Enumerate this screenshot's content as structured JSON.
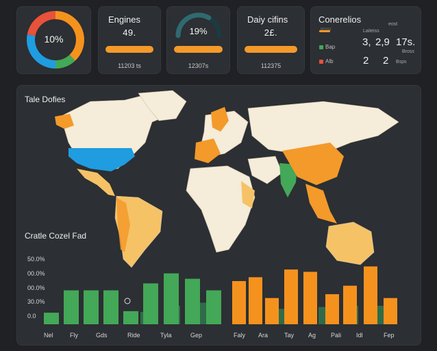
{
  "donut": {
    "label": "10%",
    "segments": [
      {
        "value": 0.38,
        "color": "#f5921e"
      },
      {
        "value": 0.12,
        "color": "#43a857"
      },
      {
        "value": 0.28,
        "color": "#1f9de0"
      },
      {
        "value": 0.22,
        "color": "#e8523a"
      }
    ]
  },
  "kpi_engines": {
    "title": "Engines",
    "value": "49.",
    "sub": "11203 ts",
    "bar_color": "#f39a2a"
  },
  "kpi_gauge": {
    "value": "19%",
    "sub": "12307s",
    "level": 0.19
  },
  "kpi_daily": {
    "title": "Daiy cifins",
    "value": "2£.",
    "sub": "112375",
    "bar_color": "#f39a2a"
  },
  "conversions": {
    "title": "Conerelios",
    "rows": [
      {
        "label": "Bross",
        "color": "#f39a2a"
      },
      {
        "label": "Bap",
        "color": "#43a857"
      },
      {
        "label": "Alb",
        "color": "#e8523a"
      }
    ],
    "small_top_a": "Laiteiss",
    "small_top_b": "eost",
    "numbers_top": [
      "3,",
      "2,9",
      "17s."
    ],
    "numbers_bottom": [
      "2",
      "2"
    ],
    "small_right_a": "Bross",
    "small_right_b": "Bsps",
    "small_right_c": "Alkeks"
  },
  "map": {
    "title": "Tale Dofies",
    "land_color": "#f5ecd9",
    "highlight_blue": "#1f9de0",
    "highlight_orange": "#f39a2a",
    "highlight_green": "#43a857",
    "highlight_lightorange": "#f6c266"
  },
  "chart_data": {
    "type": "bar",
    "title": "Cratle Cozel Fad",
    "yticks": [
      "50.0%",
      "00.0%",
      "00.0%",
      "30.0%",
      "0.0"
    ],
    "ylim": [
      0,
      100
    ],
    "categories": [
      "Nel",
      "Fly",
      "Gds",
      "Ride",
      "Tyla",
      "Gep",
      "Faly",
      "Ara",
      "Tay",
      "Ag",
      "Pali",
      "Idl",
      "Fep"
    ],
    "xtick_positions": [
      "Nel",
      "Fly",
      "Gds",
      "Ride",
      "Tyla",
      "Gep",
      "Faly",
      "Ara",
      "Tay",
      "Ag",
      "Pali",
      "Idl",
      "Fep"
    ],
    "series_green": {
      "color": "#43a857",
      "values": [
        15,
        44,
        44,
        44,
        17,
        53,
        66,
        59,
        44
      ]
    },
    "series_orange": {
      "color": "#f5921e",
      "values": [
        56,
        61,
        34,
        71,
        68,
        39,
        50,
        75,
        34
      ]
    },
    "series_dark": {
      "color": "#2f6b49"
    }
  }
}
